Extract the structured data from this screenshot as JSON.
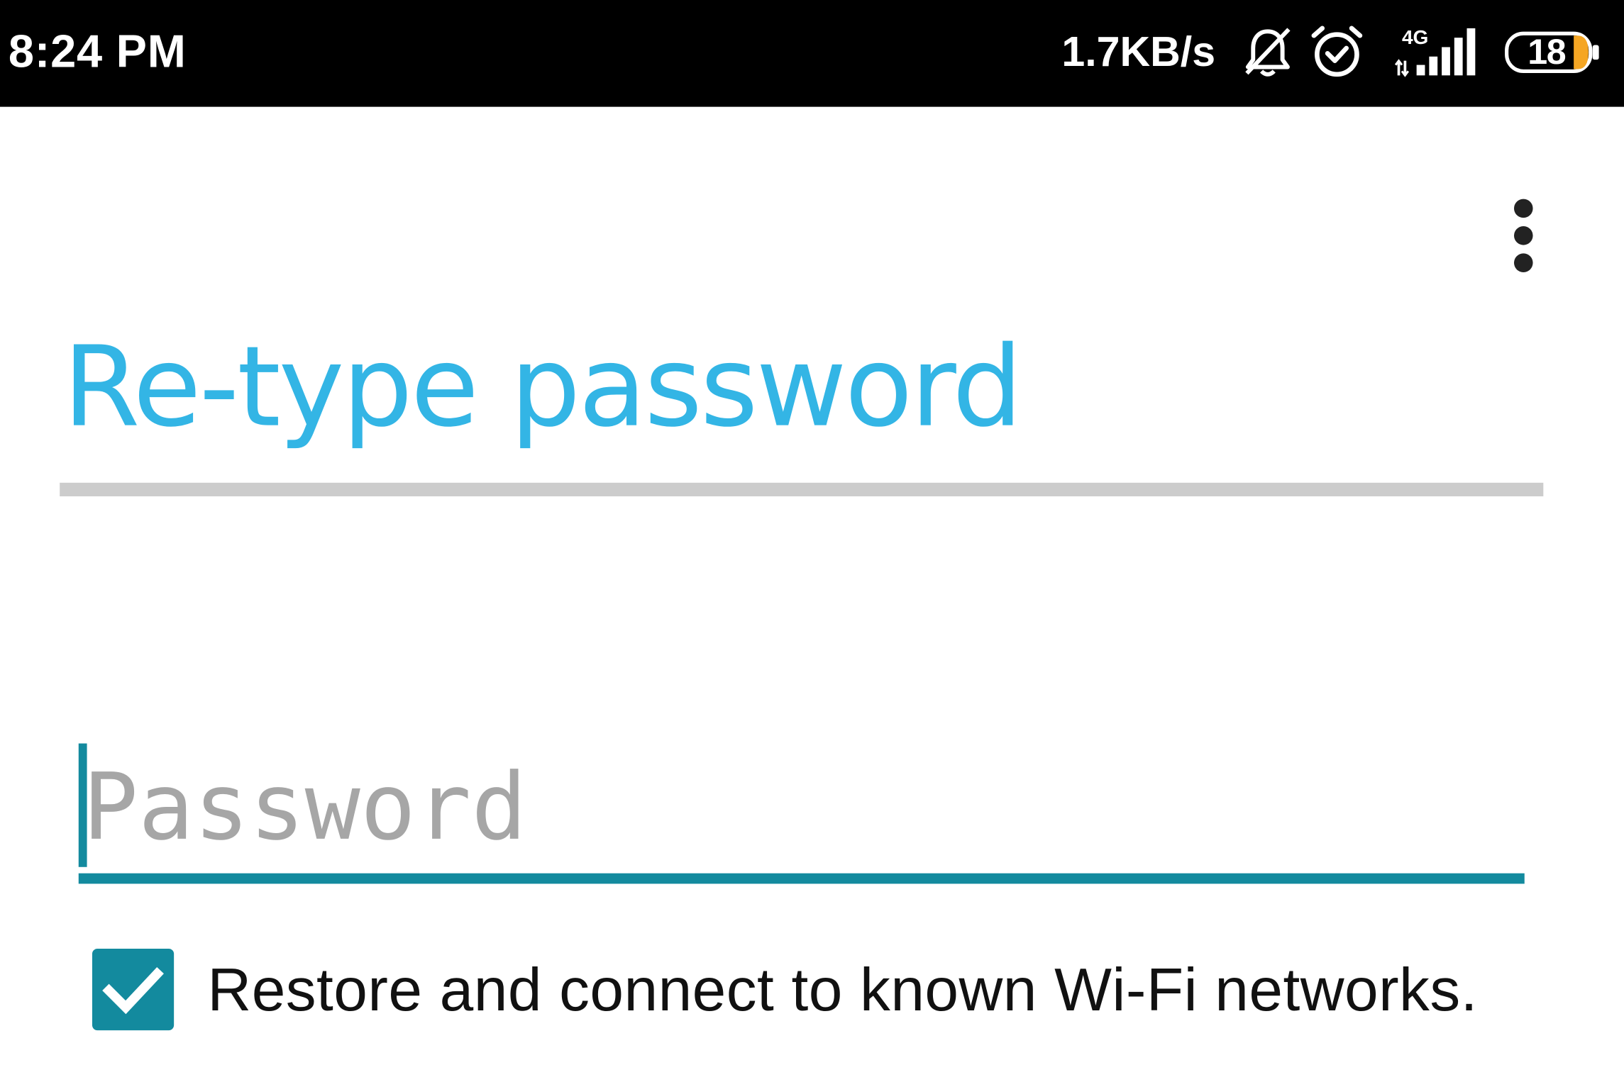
{
  "status_bar": {
    "time": "8:24 PM",
    "net_speed": "1.7KB/s",
    "network_type": "4G",
    "battery_level": "18",
    "icons": [
      "notifications-muted-icon",
      "alarm-icon",
      "signal-4g-icon",
      "battery-icon"
    ]
  },
  "toolbar": {
    "overflow_icon": "more-vertical-icon"
  },
  "page": {
    "title": "Re-type password"
  },
  "password_field": {
    "value": "",
    "placeholder": "Password"
  },
  "wifi_restore": {
    "label": "Restore and connect to known Wi-Fi networks.",
    "checked": true
  },
  "colors": {
    "accent": "#138a9e",
    "title": "#33b5e5",
    "status_bar": "#000000",
    "divider": "#cccccc",
    "battery_low": "#f5a623"
  }
}
